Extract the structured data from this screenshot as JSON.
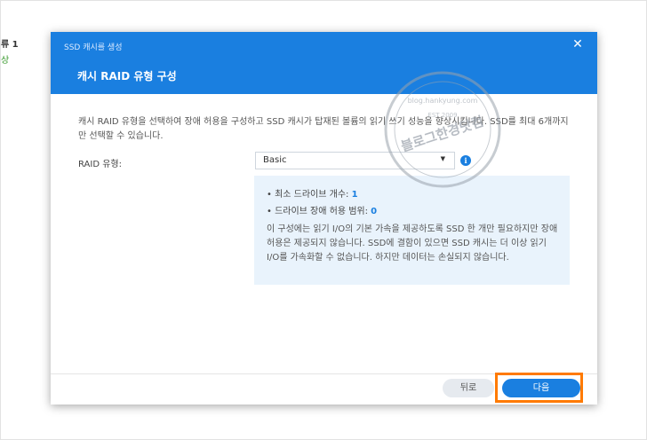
{
  "background": {
    "text_line1": "류 1",
    "text_line2": "상"
  },
  "dialog": {
    "window_title": "SSD 캐시를 생성",
    "step_title": "캐시 RAID 유형 구성",
    "description": "캐시 RAID 유형을 선택하여 장애 허용을 구성하고 SSD 캐시가 탑재된 볼륨의 읽기 쓰기 성능을 향상시킵니다. SSD를 최대 6개까지만 선택할 수 있습니다.",
    "raid_label": "RAID 유형:",
    "raid_value": "Basic",
    "info": {
      "min_drives_label": "최소 드라이브 개수:",
      "min_drives_value": "1",
      "fault_tolerance_label": "드라이브 장애 허용 범위:",
      "fault_tolerance_value": "0",
      "description": "이 구성에는 읽기 I/O의 기본 가속을 제공하도록 SSD 한 개만 필요하지만 장애 허용은 제공되지 않습니다. SSD에 결함이 있으면 SSD 캐시는 더 이상 읽기 I/O를 가속화할 수 없습니다. 하지만 데이터는 손실되지 않습니다."
    },
    "buttons": {
      "back": "뒤로",
      "next": "다음"
    }
  },
  "watermark": {
    "main_text": "블로그한경닷컴",
    "ring_text": "blog.hankyung.com",
    "est": "EST 2009"
  },
  "colors": {
    "accent": "#1a7fe0",
    "highlight": "#ff7a00"
  },
  "icons": {
    "close": "close-icon",
    "dropdown": "chevron-down-icon",
    "info": "info-icon"
  }
}
